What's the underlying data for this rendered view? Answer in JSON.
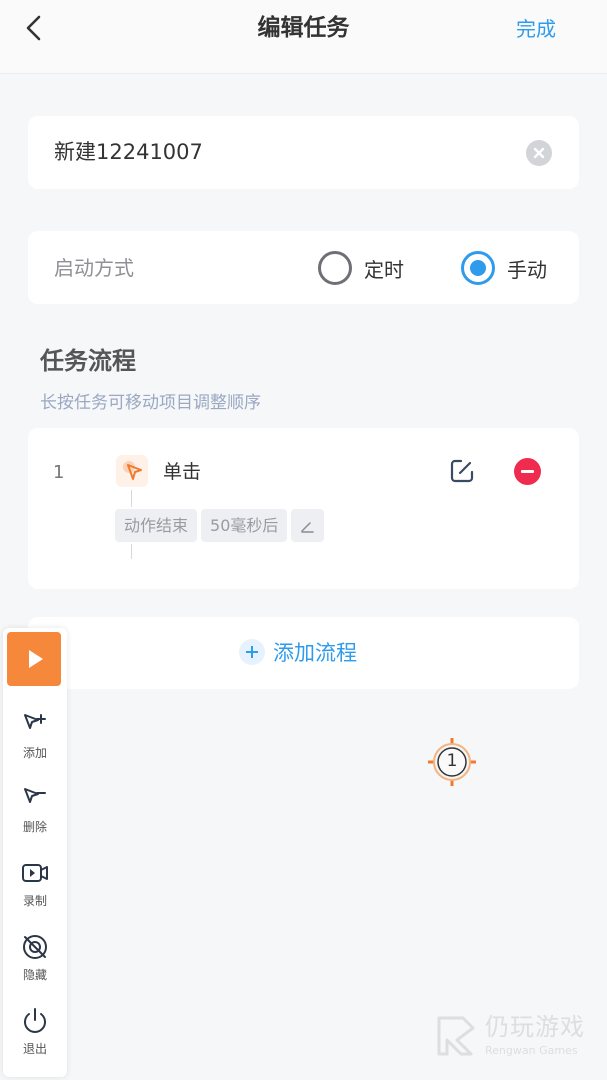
{
  "header": {
    "title": "编辑任务",
    "done_label": "完成"
  },
  "task_name": {
    "value": "新建12241007"
  },
  "start_mode": {
    "label": "启动方式",
    "options": [
      {
        "label": "定时",
        "selected": false
      },
      {
        "label": "手动",
        "selected": true
      }
    ]
  },
  "flow": {
    "title": "任务流程",
    "hint": "长按任务可移动项目调整顺序",
    "steps": [
      {
        "index": "1",
        "action": "单击",
        "icon": "tap-cursor-icon",
        "tags": [
          "动作结束",
          "50毫秒后"
        ]
      }
    ],
    "add_label": "添加流程"
  },
  "marker": {
    "number": "1"
  },
  "toolbar": {
    "items": [
      {
        "label": "添加",
        "icon": "cursor-plus-icon"
      },
      {
        "label": "删除",
        "icon": "cursor-minus-icon"
      },
      {
        "label": "录制",
        "icon": "video-record-icon"
      },
      {
        "label": "隐藏",
        "icon": "eye-off-icon"
      },
      {
        "label": "退出",
        "icon": "power-icon"
      }
    ]
  },
  "watermark": {
    "cn": "仍玩游戏",
    "en": "Rengwan Games"
  },
  "colors": {
    "accent": "#2f9bec",
    "danger": "#ef2b4f",
    "play": "#f5883a",
    "background": "#f6f7f9"
  }
}
